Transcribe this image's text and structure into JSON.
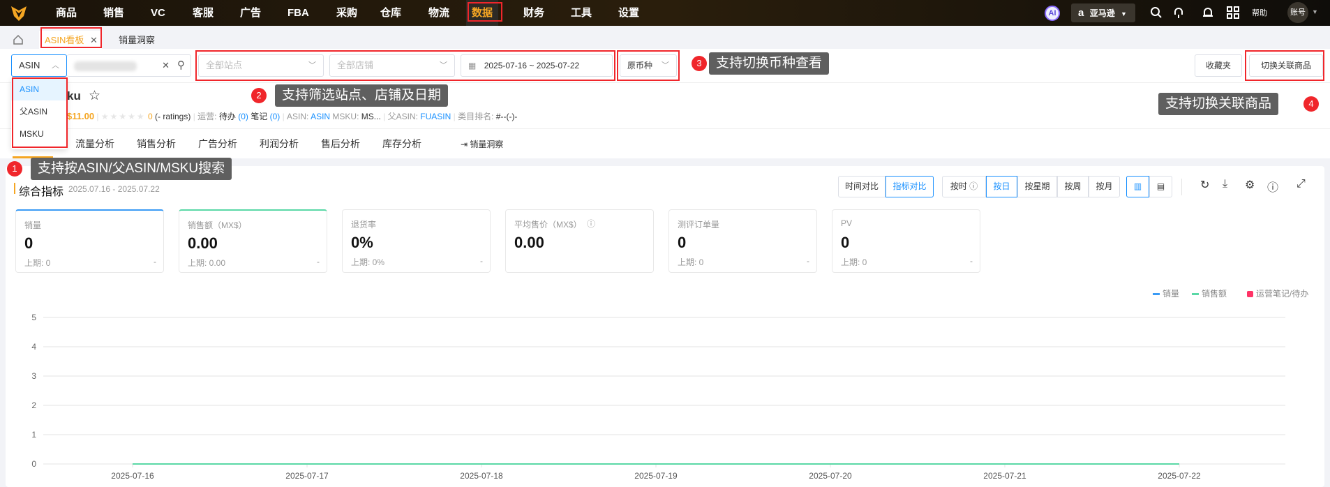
{
  "topnav": {
    "items": [
      "商品",
      "销售",
      "VC",
      "客服",
      "广告",
      "FBA",
      "采购",
      "仓库",
      "物流",
      "数据",
      "财务",
      "工具",
      "设置"
    ],
    "active": "数据",
    "ai": "AI",
    "marketplace": "亚马逊",
    "help": "帮助",
    "account": "账号"
  },
  "tabs": {
    "active": "ASIN看板",
    "other": "销量洞察"
  },
  "filters": {
    "search_type": "ASIN",
    "search_type_options": [
      "ASIN",
      "父ASIN",
      "MSKU"
    ],
    "site_placeholder": "全部站点",
    "shop_placeholder": "全部店铺",
    "date_start": "2025-07-16",
    "date_sep": "~",
    "date_end": "2025-07-22",
    "currency": "原币种",
    "favorites": "收藏夹",
    "switch_related": "切换关联商品"
  },
  "product": {
    "title": "ku",
    "price": "$11.00",
    "rating_count": "0",
    "ratings_text": "(- ratings)",
    "ops_label": "运营:",
    "todo_label": "待办",
    "todo_count": "(0)",
    "note_label": "笔记",
    "note_count": "(0)",
    "asin_label": "ASIN:",
    "asin": "ASIN",
    "msku_label": "MSKU:",
    "msku": "MS...",
    "parent_label": "父ASIN:",
    "parent": "FUASIN",
    "rank_label": "类目排名:",
    "rank": "#--(-)-"
  },
  "subtabs": [
    "流量分析",
    "销售分析",
    "广告分析",
    "利润分析",
    "售后分析",
    "库存分析"
  ],
  "subtab_link": "销量洞察",
  "panel": {
    "title": "综合指标",
    "range": "2025.07.16 - 2025.07.22",
    "compare": [
      "时间对比",
      "指标对比"
    ],
    "granularity": [
      "按时",
      "按日",
      "按星期",
      "按周",
      "按月"
    ]
  },
  "metrics": [
    {
      "title": "销量",
      "value": "0",
      "prev": "上期: 0",
      "delta": "-",
      "color": "#3a9bf5"
    },
    {
      "title": "销售额（MX$）",
      "value": "0.00",
      "prev": "上期: 0.00",
      "delta": "-",
      "color": "#5ad8a6"
    },
    {
      "title": "退货率",
      "value": "0%",
      "prev": "上期: 0%",
      "delta": "-"
    },
    {
      "title": "平均售价（MX$）",
      "value": "0.00"
    },
    {
      "title": "测评订单量",
      "value": "0",
      "prev": "上期: 0",
      "delta": "-"
    },
    {
      "title": "PV",
      "value": "0",
      "prev": "上期: 0",
      "delta": "-"
    }
  ],
  "annotations": [
    {
      "n": "1",
      "text": "支持按ASIN/父ASIN/MSKU搜索"
    },
    {
      "n": "2",
      "text": "支持筛选站点、店铺及日期"
    },
    {
      "n": "3",
      "text": "支持切换币种查看"
    },
    {
      "n": "4",
      "text": "支持切换关联商品"
    }
  ],
  "chart_data": {
    "type": "line",
    "categories": [
      "2025-07-16",
      "2025-07-17",
      "2025-07-18",
      "2025-07-19",
      "2025-07-20",
      "2025-07-21",
      "2025-07-22"
    ],
    "series": [
      {
        "name": "销量",
        "values": [
          0,
          0,
          0,
          0,
          0,
          0,
          0
        ],
        "color": "#3a9bf5"
      },
      {
        "name": "销售额",
        "values": [
          0,
          0,
          0,
          0,
          0,
          0,
          0
        ],
        "color": "#5ad8a6"
      }
    ],
    "legend_extra": "运营笔记/待办",
    "ylim": [
      0,
      5
    ],
    "yticks": [
      0,
      1,
      2,
      3,
      4,
      5
    ],
    "grid": true,
    "legend": "top-right"
  }
}
